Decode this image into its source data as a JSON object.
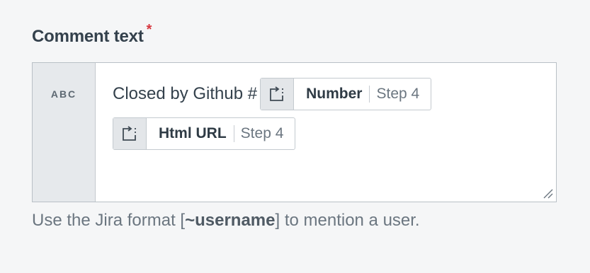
{
  "field": {
    "label": "Comment text",
    "required_marker": "*",
    "type_badge": "ABC",
    "editor": {
      "text_before_tokens": "Closed by Github #",
      "tokens": [
        {
          "icon": "step-reference-icon",
          "name": "Number",
          "step": "Step 4"
        },
        {
          "icon": "step-reference-icon",
          "name": "Html URL",
          "step": "Step 4"
        }
      ]
    },
    "help": {
      "prefix": "Use the Jira format [",
      "highlight": "~username",
      "suffix": "] to mention a user."
    }
  },
  "colors": {
    "required": "#d7373f",
    "token_icon_bg": "#e3e6e9",
    "gutter_bg": "#e6e9ec"
  }
}
